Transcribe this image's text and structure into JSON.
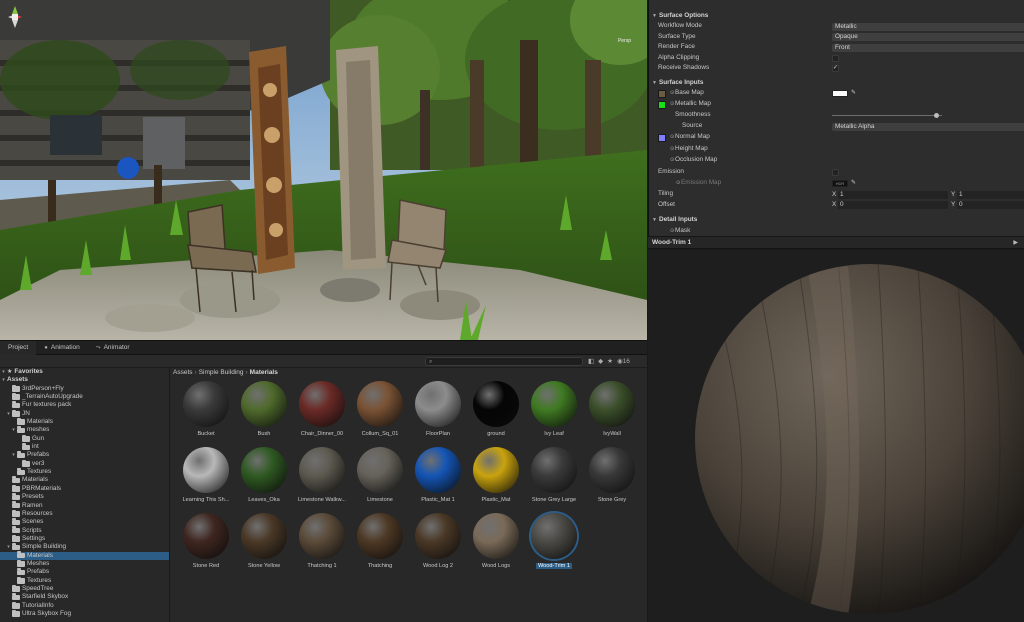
{
  "scene": {
    "gizmo_label": "Persp"
  },
  "tabs": [
    {
      "label": "Project",
      "icon": "folder-icon"
    },
    {
      "label": "Animation",
      "icon": "animation-icon"
    },
    {
      "label": "Animator",
      "icon": "animator-icon"
    }
  ],
  "project_toolbar": {
    "search_placeholder": "",
    "visible_count": "16"
  },
  "breadcrumb": {
    "part1": "Assets",
    "part2": "Simple Building",
    "current": "Materials"
  },
  "tree": [
    {
      "label": "Favorites",
      "indent": 0,
      "type": "header-fav"
    },
    {
      "label": "Assets",
      "indent": 0,
      "type": "header"
    },
    {
      "label": "3rdPerson+Fly",
      "indent": 1,
      "type": "folder"
    },
    {
      "label": "_TerrainAutoUpgrade",
      "indent": 1,
      "type": "folder"
    },
    {
      "label": "Fur textures pack",
      "indent": 1,
      "type": "folder"
    },
    {
      "label": "JN",
      "indent": 1,
      "type": "folder-open"
    },
    {
      "label": "Materials",
      "indent": 2,
      "type": "folder"
    },
    {
      "label": "meshes",
      "indent": 2,
      "type": "folder-open"
    },
    {
      "label": "Gun",
      "indent": 3,
      "type": "folder"
    },
    {
      "label": "int",
      "indent": 3,
      "type": "folder"
    },
    {
      "label": "Prefabs",
      "indent": 2,
      "type": "folder-open"
    },
    {
      "label": "ver3",
      "indent": 3,
      "type": "folder"
    },
    {
      "label": "Textures",
      "indent": 2,
      "type": "folder"
    },
    {
      "label": "Materials",
      "indent": 1,
      "type": "folder"
    },
    {
      "label": "PBRMaterials",
      "indent": 1,
      "type": "folder"
    },
    {
      "label": "Presets",
      "indent": 1,
      "type": "folder"
    },
    {
      "label": "Ramen",
      "indent": 1,
      "type": "folder"
    },
    {
      "label": "Resources",
      "indent": 1,
      "type": "folder"
    },
    {
      "label": "Scenes",
      "indent": 1,
      "type": "folder"
    },
    {
      "label": "Scripts",
      "indent": 1,
      "type": "folder"
    },
    {
      "label": "Settings",
      "indent": 1,
      "type": "folder"
    },
    {
      "label": "Simple Building",
      "indent": 1,
      "type": "folder-open"
    },
    {
      "label": "Materials",
      "indent": 2,
      "type": "folder",
      "selected": true
    },
    {
      "label": "Meshes",
      "indent": 2,
      "type": "folder"
    },
    {
      "label": "Prefabs",
      "indent": 2,
      "type": "folder"
    },
    {
      "label": "Textures",
      "indent": 2,
      "type": "folder"
    },
    {
      "label": "SpeedTree",
      "indent": 1,
      "type": "folder"
    },
    {
      "label": "Starfield Skybox",
      "indent": 1,
      "type": "folder"
    },
    {
      "label": "TutorialInfo",
      "indent": 1,
      "type": "folder"
    },
    {
      "label": "Ultra Skybox Fog",
      "indent": 1,
      "type": "folder"
    }
  ],
  "materials": [
    {
      "name": "Bucket",
      "color": "#3a3a3a"
    },
    {
      "name": "Bush",
      "color": "#4f6a2c"
    },
    {
      "name": "Chair_Dinner_00",
      "color": "#6b2a26"
    },
    {
      "name": "Collum_Sq_01",
      "color": "#7a5234"
    },
    {
      "name": "FloorPlan",
      "color": "#8c8c8c"
    },
    {
      "name": "ground",
      "color": "#050505"
    },
    {
      "name": "Ivy Leaf",
      "color": "#3f7a22"
    },
    {
      "name": "IvyWall",
      "color": "#3b4f2a"
    },
    {
      "name": "Learning This Sh...",
      "color": "#b8b8b8"
    },
    {
      "name": "Leaves_Oka",
      "color": "#2f5a22"
    },
    {
      "name": "Limestone Walkw...",
      "color": "#5d5a50"
    },
    {
      "name": "Limestone",
      "color": "#66625a"
    },
    {
      "name": "Plastic_Mat 1",
      "color": "#1455b5"
    },
    {
      "name": "Plastic_Mat",
      "color": "#c9a30e"
    },
    {
      "name": "Stone Grey Large",
      "color": "#3a3a3a"
    },
    {
      "name": "Stone Grey",
      "color": "#383838"
    },
    {
      "name": "Stone Red",
      "color": "#3f2620"
    },
    {
      "name": "Stone Yellow",
      "color": "#4a3826"
    },
    {
      "name": "Thatching 1",
      "color": "#5a4a38"
    },
    {
      "name": "Thatching",
      "color": "#4d3824"
    },
    {
      "name": "Wood Log 2",
      "color": "#4a3826"
    },
    {
      "name": "Wood Logs",
      "color": "#7a6a58"
    },
    {
      "name": "Wood-Trim 1",
      "color": "#4c4a45",
      "selected": true
    }
  ],
  "inspector": {
    "surface_options": "Surface Options",
    "workflow_mode_label": "Workflow Mode",
    "workflow_mode_value": "Metallic",
    "surface_type_label": "Surface Type",
    "surface_type_value": "Opaque",
    "render_face_label": "Render Face",
    "render_face_value": "Front",
    "alpha_clipping_label": "Alpha Clipping",
    "receive_shadows_label": "Receive Shadows",
    "receive_shadows_check": "✓",
    "surface_inputs": "Surface Inputs",
    "base_map_label": "Base Map",
    "base_map_color": "#6b5d44",
    "metallic_map_label": "Metallic Map",
    "metallic_map_color": "#16e016",
    "smoothness_label": "Smoothness",
    "smoothness_value": 0.95,
    "source_label": "Source",
    "source_value": "Metallic Alpha",
    "normal_map_label": "Normal Map",
    "normal_map_color": "#8080ff",
    "height_map_label": "Height Map",
    "occlusion_map_label": "Occlusion Map",
    "emission_label": "Emission",
    "emission_map_label": "Emission Map",
    "emission_color_text": "HDR",
    "tiling_label": "Tiling",
    "tiling_x_label": "X",
    "tiling_x": "1",
    "tiling_y_label": "Y",
    "tiling_y": "1",
    "offset_label": "Offset",
    "offset_x_label": "X",
    "offset_x": "0",
    "offset_y_label": "Y",
    "offset_y": "0",
    "detail_inputs": "Detail Inputs",
    "mask_label": "Mask"
  },
  "preview": {
    "title": "Wood-Trim 1"
  }
}
